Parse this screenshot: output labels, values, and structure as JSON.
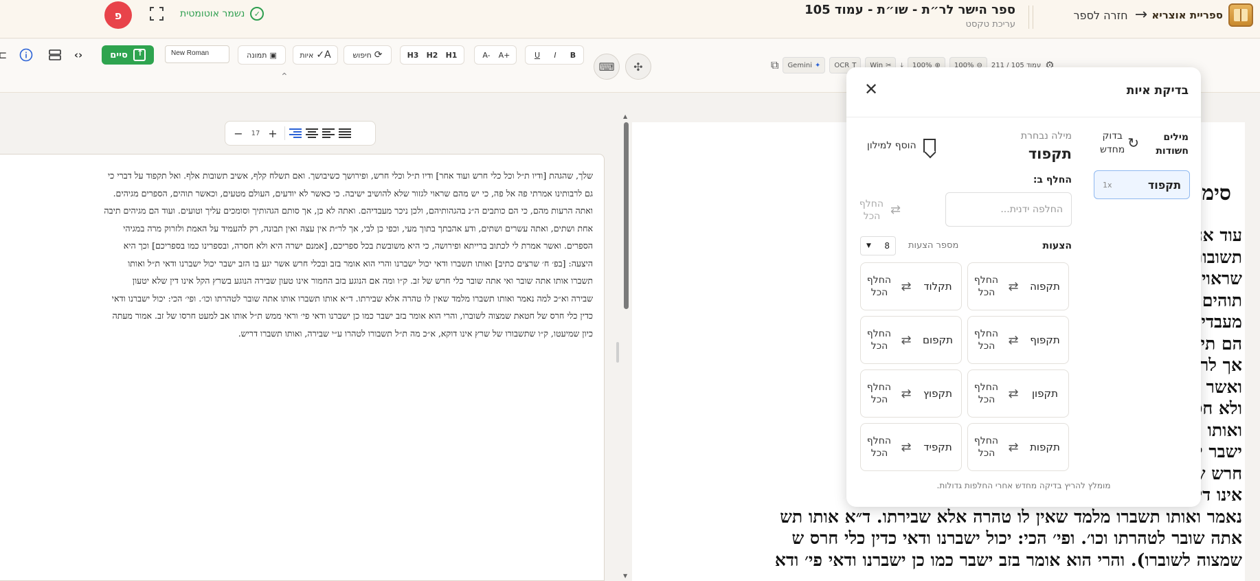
{
  "header": {
    "brand": "ספריית אוצריא",
    "back_label": "חזרה לספר",
    "doc_title": "ספר הישר לר״ת - שו״ת - עמוד 105",
    "doc_subtitle": "עריכת טקסט",
    "avatar_initial": "פ",
    "autosave_label": "נשמר אוטומטית"
  },
  "toolbar": {
    "bold": "B",
    "italic": "I",
    "underline": "U",
    "font_increase": "A+",
    "font_decrease": "A-",
    "h1": "H1",
    "h2": "H2",
    "h3": "H3",
    "search_label": "חיפוש",
    "spell_label": "איות",
    "image_label": "תמונה",
    "font_name": "New Roman",
    "done_label": "סיים",
    "right_tools": {
      "zoom_out": "100%",
      "zoom_in": "100%",
      "page_indicator": "עמוד 105 / 211",
      "gemini": "Gemini",
      "ocr": "OCR",
      "win": "Win"
    }
  },
  "format_bar": {
    "font_size": "17"
  },
  "editor": {
    "lines": [
      "שלך, שהגהת [ודיו ת״ל וכל כלי חרש ועוד אחר] ודיו ת״ל וכלי חרש, ופירושך כשיבושך. ואם תשלח קלף, אשיב תשובות אלף. ואל תקפוד על דברי כי",
      "גם לרבותינו אמרתי פה אל פה, כי יש מהם שראוי לגזור שלא להושיב ישיבה. כי כאשר לא יודעים, העולם מטעים, וכאשר תוהים, הספרים מגיהים.",
      "ואתה הרעות מהם, כי הם כותבים ה״נ בהגהותיהם, ולכן ניכר מעבדיהם. ואתה לא כן, אך סותם הגהותיך וסומכים עליך וטועים. ועוד הם מגיהים תיבה",
      "אחת ושתים, ואתה עשרים ושתים, ודע אהבתך בתוך מעי, וכפי כן לבי, אך לר״ת אין עצה ואין תבונה, רק להעמיד על האמת ולזרוק מרה במגיהי",
      "הספרים. ואשר אמרת לי לכתוב ברייתא ופירושה, כי היא משובשת בכל ספריכם, [אמנם ישרה היא ולא חסרה, ובספרינו כמו בספריכם] וכך היא",
      "היצעה: [בפ׳ ח׳ שרצים כתיב] ואותו תשברו ודאי יכול ישברנו והרי הוא אומר בזב ובכלי חרש אשר יגע בו הזב ישבר יכול ישברנו ודאי ת״ל ואותו",
      "תשברו אותו אתה שובר ואי אתה שובר כלי חרש של זב. ק״ו ומה אם הנוגע בזב החמור אינו טעון שבירה הנוגע בשרץ הקל אינו דין שלא יטעון",
      "שבירה וא״כ למה נאמר ואותו תשברו מלמד שאין לו טהרה אלא שבירתו. ד״א אותו תשברו אותו אתה שובר לטהרתו וכו׳. ופי׳ הכי: יכול ישברנו ודאי",
      "כדין כלי חרס של חטאת שמצוה לשוברו, והרי הוא אומר בזב ישבר כמו כן ישברנו ודאי פי׳ וראי ממש ת״ל אותו אב למעט חרסו של זב. אמור מעתה",
      "כיון שמיעטו, ק״ו שתשבורו של שרץ אינו דוקא, א״כ מה ת״ל תשבורו לטהרו ע״י שבירה, ואותו תשברו דריש."
    ]
  },
  "scan": {
    "heading": "סימן נ",
    "lines": [
      "עוד אחר]א)  ודיו  ת״ל  וכל",
      "תשובות  אלף.  ואל  תקפוד  על",
      "שראוי  לגזור  שלא  להושיב",
      "תוהים,  הספרים  מגיהים.  ואתה",
      "מעבדיהם.  ואתה  לא  כן,  א",
      "הם  תיבה  אחת  ושתים,  ואתה",
      "אך  לר״ת  אין  עצה  ואין  תו",
      "ואשר  אמרת  לי  לכתוב  ברייתא",
      "ולא  חסרה,  ובספרינו  כמו  בס",
      "ואותו  תשברו  ודאי  יכול  ישב",
      "ישבר  יכול  ישברנו  ודאי  ת״",
      "חרש  של  זב.  ק״ו  ומה  אם  ה",
      "אינו  דין  שלא  יטעון  שבירה",
      "נאמר  ואותו  תשברו  מלמד  שאין  לו  טהרה  אלא  שבירתו.  ד״א  אותו  תש",
      "אתה  שובר  לטהרתו  וכו׳.  ופי׳  הכי:  יכול  ישברנו  ודאי  כדין  כלי  חרס  ש",
      "שמצוה  לשוברו).  והרי  הוא  אומר  בזב  ישבר  כמו  כן  ישברנו  ודאי  פי׳  ודא"
    ]
  },
  "spell_panel": {
    "title": "בדיקת איות",
    "suspicious_title": "מילים חשודות",
    "recheck_label": "בדוק מחדש",
    "suspicious_words": [
      {
        "word": "תקפוד",
        "count": "1x"
      }
    ],
    "selected_caption": "מילה נבחרת",
    "selected_word": "תקפוד",
    "add_to_dict": "הוסף למילון",
    "replace_caption": "החלף ב:",
    "replace_placeholder": "החלפה ידנית...",
    "replace_all": "החלף הכל",
    "suggestions_caption": "הצעות",
    "suggestion_count_caption": "מספר הצעות",
    "suggestion_count": "8",
    "suggestions": [
      {
        "word": "תקפוה",
        "action": "החלף הכל"
      },
      {
        "word": "תקלוד",
        "action": "החלף הכל"
      },
      {
        "word": "תקפוף",
        "action": "החלף הכל"
      },
      {
        "word": "תקפום",
        "action": "החלף הכל"
      },
      {
        "word": "תקפון",
        "action": "החלף הכל"
      },
      {
        "word": "תקפוץ",
        "action": "החלף הכל"
      },
      {
        "word": "תקפות",
        "action": "החלף הכל"
      },
      {
        "word": "תקפיד",
        "action": "החלף הכל"
      }
    ],
    "note": "מומלץ להריץ בדיקה מחדש אחרי החלפות גדולות."
  },
  "colors": {
    "accent_green": "#2ea44f",
    "avatar_red": "#e8434a",
    "selection_blue": "#2b62d6"
  }
}
